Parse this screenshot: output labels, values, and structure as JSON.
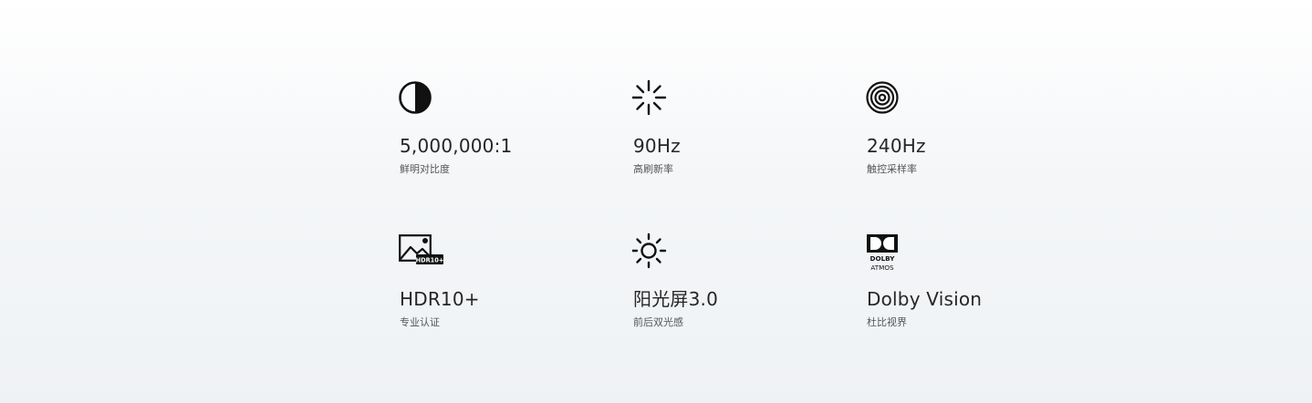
{
  "features": [
    {
      "icon": "contrast-icon",
      "value": "5,000,000:1",
      "label": "鲜明对比度"
    },
    {
      "icon": "refresh-rate-icon",
      "value": "90Hz",
      "label": "高刷新率"
    },
    {
      "icon": "touch-sampling-icon",
      "value": "240Hz",
      "label": "触控采样率"
    },
    {
      "icon": "hdr10-plus-icon",
      "icon_text": "HDR10+",
      "value": "HDR10+",
      "label": "专业认证"
    },
    {
      "icon": "sun-icon",
      "value": "阳光屏3.0",
      "label": "前后双光感"
    },
    {
      "icon": "dolby-atmos-icon",
      "icon_text": [
        "DOLBY",
        "ATMOS"
      ],
      "value": "Dolby Vision",
      "label": "杜比视界"
    }
  ]
}
